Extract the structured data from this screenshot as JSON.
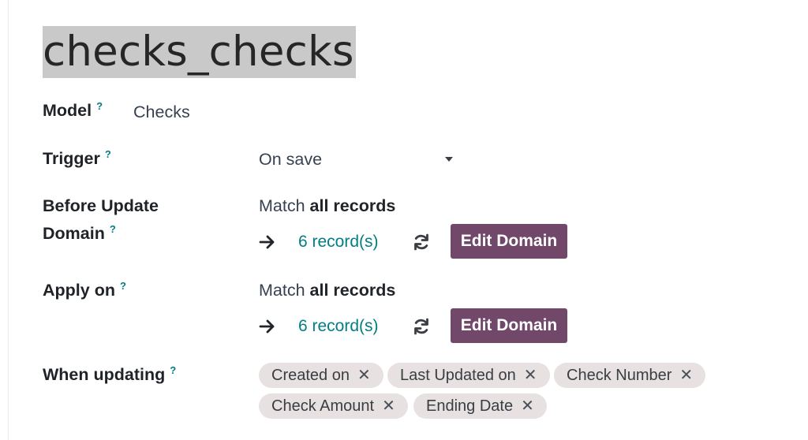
{
  "record": {
    "title": "checks_checks"
  },
  "fields": {
    "model": {
      "label": "Model",
      "help": "?",
      "value": "Checks"
    },
    "trigger": {
      "label": "Trigger",
      "help": "?",
      "value": "On save"
    },
    "before_update_domain": {
      "label_line1": "Before Update",
      "label_line2": "Domain",
      "help": "?",
      "match_prefix": "Match",
      "match_strong": "all records",
      "records_link": "6 record(s)",
      "edit_button": "Edit Domain"
    },
    "apply_on": {
      "label": "Apply on",
      "help": "?",
      "match_prefix": "Match",
      "match_strong": "all records",
      "records_link": "6 record(s)",
      "edit_button": "Edit Domain"
    },
    "when_updating": {
      "label": "When updating",
      "help": "?",
      "tags": [
        {
          "label": "Created on",
          "remove": "✕"
        },
        {
          "label": "Last Updated on",
          "remove": "✕"
        },
        {
          "label": "Check Number",
          "remove": "✕"
        },
        {
          "label": "Check Amount",
          "remove": "✕"
        },
        {
          "label": "Ending Date",
          "remove": "✕"
        }
      ]
    }
  },
  "colors": {
    "accent_teal": "#017e84",
    "primary_button": "#71476a",
    "tag_background": "#e7e1e1",
    "title_highlight": "#c9c9c9"
  }
}
